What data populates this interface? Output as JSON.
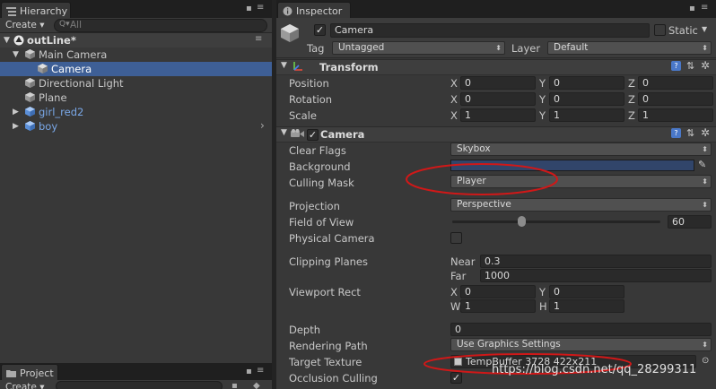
{
  "hierarchy": {
    "tab_label": "Hierarchy",
    "create_label": "Create ▾",
    "search_placeholder": "All",
    "scene_name": "outLine*",
    "items": [
      {
        "label": "Main Camera"
      },
      {
        "label": "Camera"
      },
      {
        "label": "Directional Light"
      },
      {
        "label": "Plane"
      },
      {
        "label": "girl_red2"
      },
      {
        "label": "boy"
      }
    ]
  },
  "project": {
    "tab_label": "Project",
    "create_label": "Create ▾"
  },
  "inspector": {
    "tab_label": "Inspector",
    "object_name": "Camera",
    "static_label": "Static",
    "tag_label": "Tag",
    "tag_value": "Untagged",
    "layer_label": "Layer",
    "layer_value": "Default",
    "transform": {
      "title": "Transform",
      "position_label": "Position",
      "rotation_label": "Rotation",
      "scale_label": "Scale",
      "axis_x": "X",
      "axis_y": "Y",
      "axis_z": "Z",
      "position": [
        "0",
        "0",
        "0"
      ],
      "rotation": [
        "0",
        "0",
        "0"
      ],
      "scale": [
        "1",
        "1",
        "1"
      ]
    },
    "camera": {
      "title": "Camera",
      "clear_flags_label": "Clear Flags",
      "clear_flags_value": "Skybox",
      "background_label": "Background",
      "background_color": "#31456a",
      "culling_mask_label": "Culling Mask",
      "culling_mask_value": "Player",
      "projection_label": "Projection",
      "projection_value": "Perspective",
      "fov_label": "Field of View",
      "fov_value": "60",
      "fov_slider_fraction": 0.333,
      "physical_camera_label": "Physical Camera",
      "clipping_planes_label": "Clipping Planes",
      "near_label": "Near",
      "near_value": "0.3",
      "far_label": "Far",
      "far_value": "1000",
      "viewport_rect_label": "Viewport Rect",
      "vp_x_label": "X",
      "vp_x": "0",
      "vp_y_label": "Y",
      "vp_y": "0",
      "vp_w_label": "W",
      "vp_w": "1",
      "vp_h_label": "H",
      "vp_h": "1",
      "depth_label": "Depth",
      "depth_value": "0",
      "rendering_path_label": "Rendering Path",
      "rendering_path_value": "Use Graphics Settings",
      "target_texture_label": "Target Texture",
      "target_texture_value": "TempBuffer 3728 422x211",
      "occlusion_culling_label": "Occlusion Culling"
    }
  },
  "watermark": "https://blog.csdn.net/qq_28299311",
  "colors": {
    "selection": "#3e5f96",
    "annotation": "#d01818",
    "prefab_blue": "#7aa8e8"
  }
}
